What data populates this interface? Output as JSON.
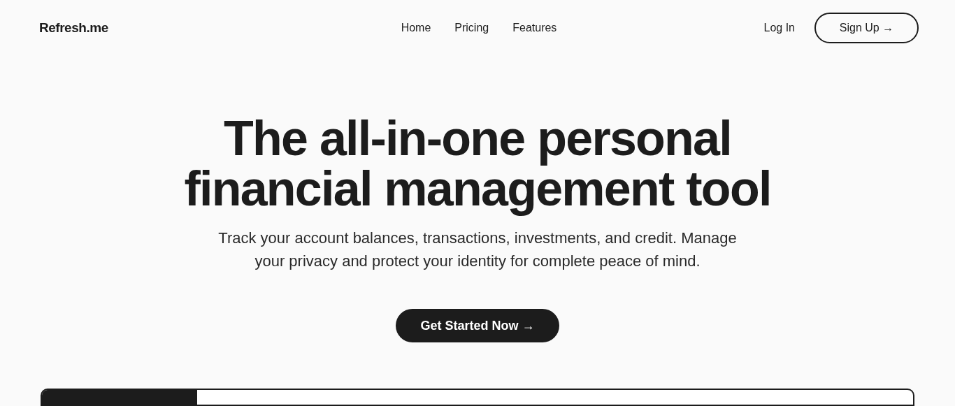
{
  "logo": "Refresh.me",
  "nav": [
    {
      "label": "Home"
    },
    {
      "label": "Pricing"
    },
    {
      "label": "Features"
    }
  ],
  "login": "Log In",
  "signup": "Sign Up →",
  "hero": {
    "title_lines": [
      "The all-in-one personal",
      "financial management tool"
    ],
    "subtitle_lines": [
      "Track your account balances, transactions, investments, and credit. Manage",
      "your privacy and protect your identity for complete peace of mind."
    ],
    "cta": "Get Started Now →"
  }
}
